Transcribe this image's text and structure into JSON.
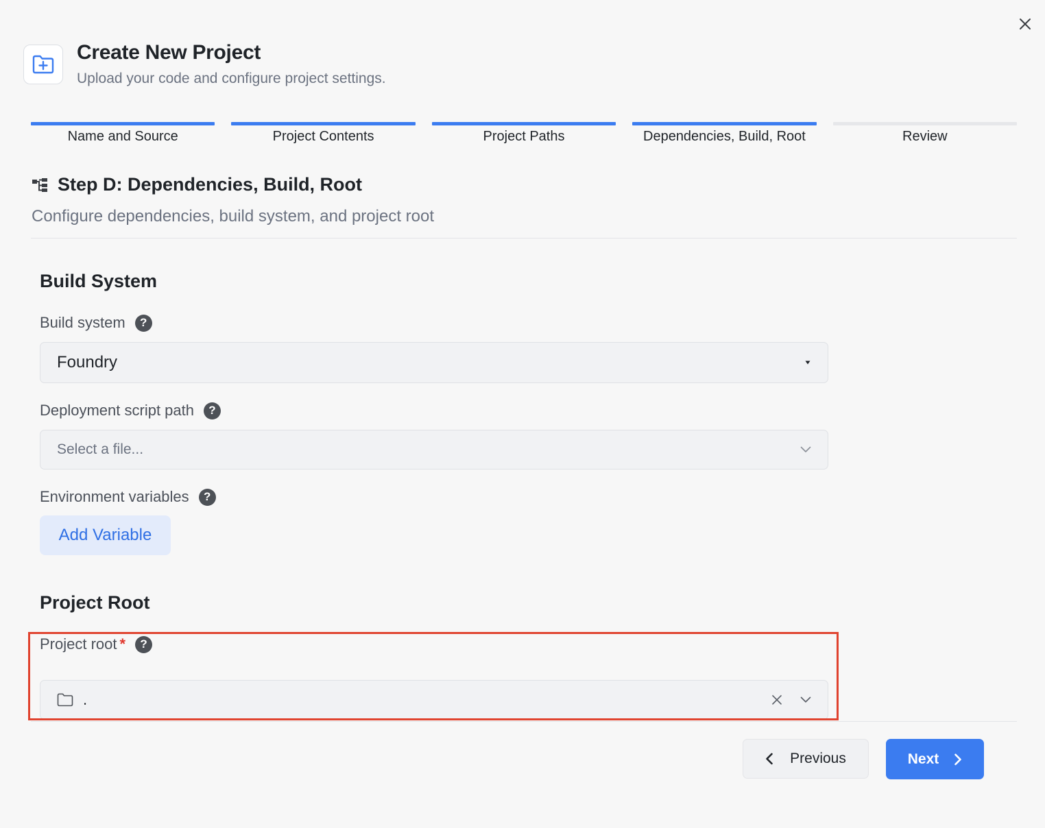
{
  "header": {
    "title": "Create New Project",
    "subtitle": "Upload your code and configure project settings.",
    "icon": "folder-plus-icon"
  },
  "stepper": {
    "steps": [
      {
        "label": "Name and Source",
        "completed": true
      },
      {
        "label": "Project Contents",
        "completed": true
      },
      {
        "label": "Project Paths",
        "completed": true
      },
      {
        "label": "Dependencies, Build, Root",
        "completed": true
      },
      {
        "label": "Review",
        "completed": false
      }
    ]
  },
  "section": {
    "title": "Step D: Dependencies, Build, Root",
    "description": "Configure dependencies, build system, and project root",
    "icon": "hierarchy-icon"
  },
  "build": {
    "group_title": "Build System",
    "build_system_label": "Build system",
    "build_system_value": "Foundry",
    "deploy_label": "Deployment script path",
    "deploy_placeholder": "Select a file...",
    "env_label": "Environment variables",
    "add_variable_label": "Add Variable"
  },
  "root": {
    "group_title": "Project Root",
    "label": "Project root",
    "required_mark": "*",
    "value": "."
  },
  "help_glyph": "?",
  "footer": {
    "previous_label": "Previous",
    "next_label": "Next"
  },
  "colors": {
    "accent": "#3b7cf0",
    "highlight": "#e0432f",
    "required": "#e0372d"
  }
}
